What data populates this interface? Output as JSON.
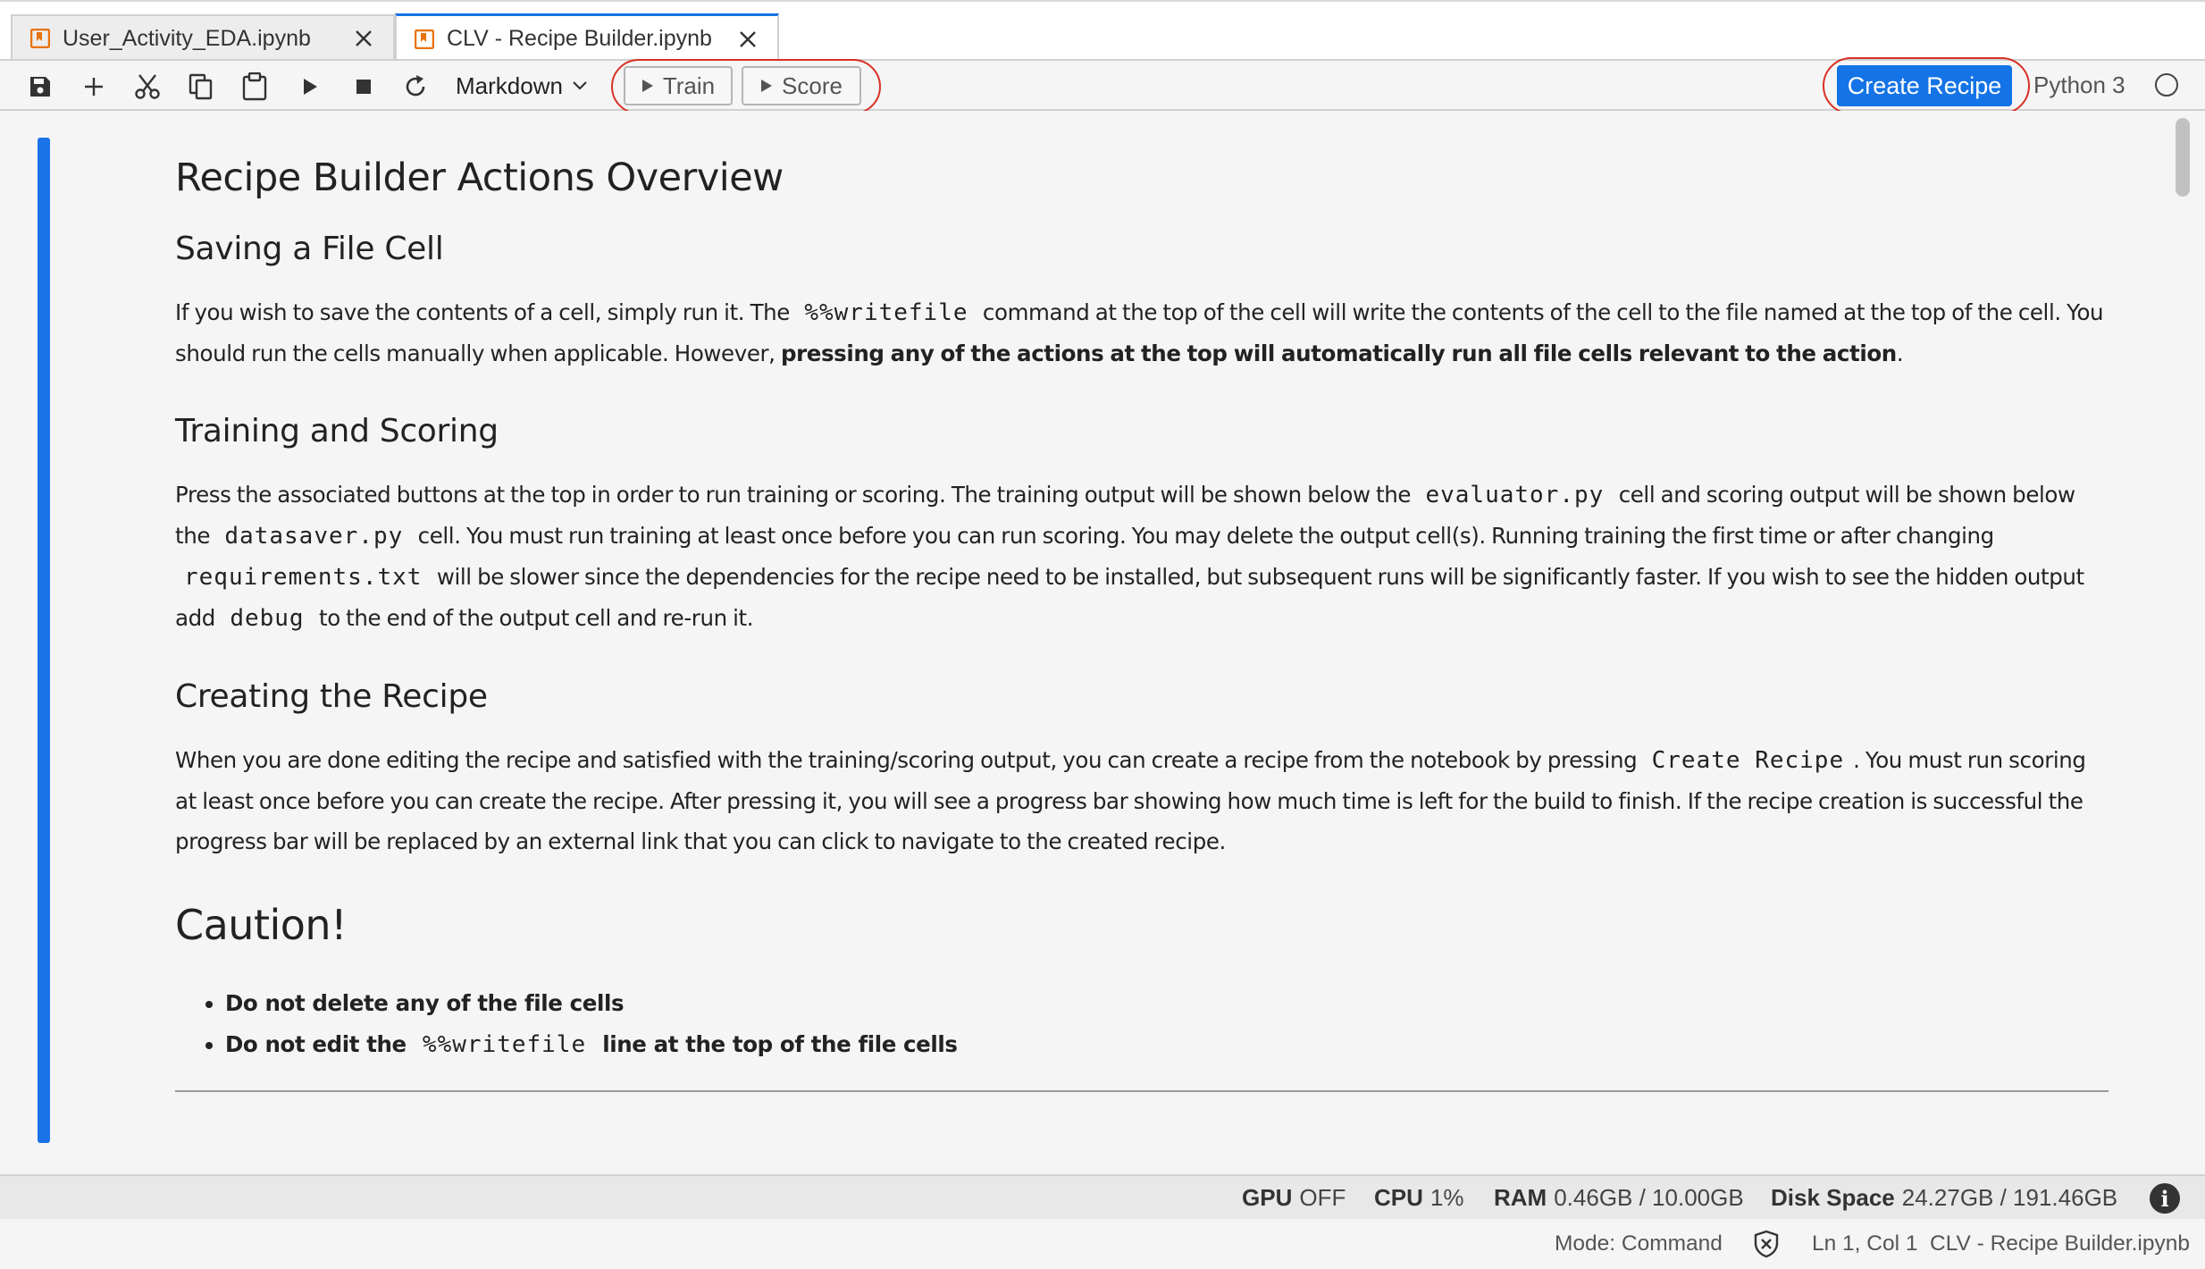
{
  "tabs": [
    {
      "label": "User_Activity_EDA.ipynb",
      "active": false
    },
    {
      "label": "CLV - Recipe Builder.ipynb",
      "active": true
    }
  ],
  "toolbar": {
    "icons": [
      "save-icon",
      "add-icon",
      "cut-icon",
      "copy-icon",
      "paste-icon",
      "run-icon",
      "stop-icon",
      "restart-icon"
    ],
    "cell_type": "Markdown",
    "train_label": "Train",
    "score_label": "Score",
    "create_recipe_label": "Create Recipe",
    "kernel_name": "Python 3"
  },
  "colors": {
    "accent": "#1473e6",
    "cell_bar": "#1a73e8",
    "highlight_ring": "#d93025",
    "notebook_icon": "#e8730c"
  },
  "notebook": {
    "title": "Recipe Builder Actions Overview",
    "section1": {
      "heading": "Saving a File Cell",
      "p_pre": "If you wish to save the contents of a cell, simply run it. The",
      "code1": "%%writefile",
      "p_mid": "command at the top of the cell will write the contents of the cell to the file named at the top of the cell. You should run the cells manually when applicable. However,",
      "bold": "pressing any of the actions at the top will automatically run all file cells relevant to the action",
      "p_end": "."
    },
    "section2": {
      "heading": "Training and Scoring",
      "t1": "Press the associated buttons at the top in order to run training or scoring. The training output will be shown below the",
      "code1": "evaluator.py",
      "t2": "cell and scoring output will be shown below the",
      "code2": "datasaver.py",
      "t3": "cell. You must run training at least once before you can run scoring. You may delete the output cell(s). Running training the first time or after changing",
      "code3": "requirements.txt",
      "t4": "will be slower since the dependencies for the recipe need to be installed, but subsequent runs will be significantly faster. If you wish to see the hidden output add",
      "code4": "debug",
      "t5": "to the end of the output cell and re-run it."
    },
    "section3": {
      "heading": "Creating the Recipe",
      "t1": "When you are done editing the recipe and satisfied with the training/scoring output, you can create a recipe from the notebook by pressing",
      "code1": "Create Recipe",
      "t2": ". You must run scoring at least once before you can create the recipe. After pressing it, you will see a progress bar showing how much time is left for the build to finish. If the recipe creation is successful the progress bar will be replaced by an external link that you can click to navigate to the created recipe."
    },
    "caution": {
      "heading": "Caution!",
      "item1": "Do not delete any of the file cells",
      "item2_pre": "Do not edit the",
      "item2_code": "%%writefile",
      "item2_post": "line at the top of the file cells"
    }
  },
  "resources": {
    "gpu_label": "GPU",
    "gpu_value": "OFF",
    "cpu_label": "CPU",
    "cpu_value": "1%",
    "ram_label": "RAM",
    "ram_value": "0.46GB / 10.00GB",
    "disk_label": "Disk Space",
    "disk_value": "24.27GB / 191.46GB",
    "info_icon_text": "i"
  },
  "status": {
    "mode": "Mode: Command",
    "position": "Ln 1, Col 1",
    "file": "CLV - Recipe Builder.ipynb"
  }
}
